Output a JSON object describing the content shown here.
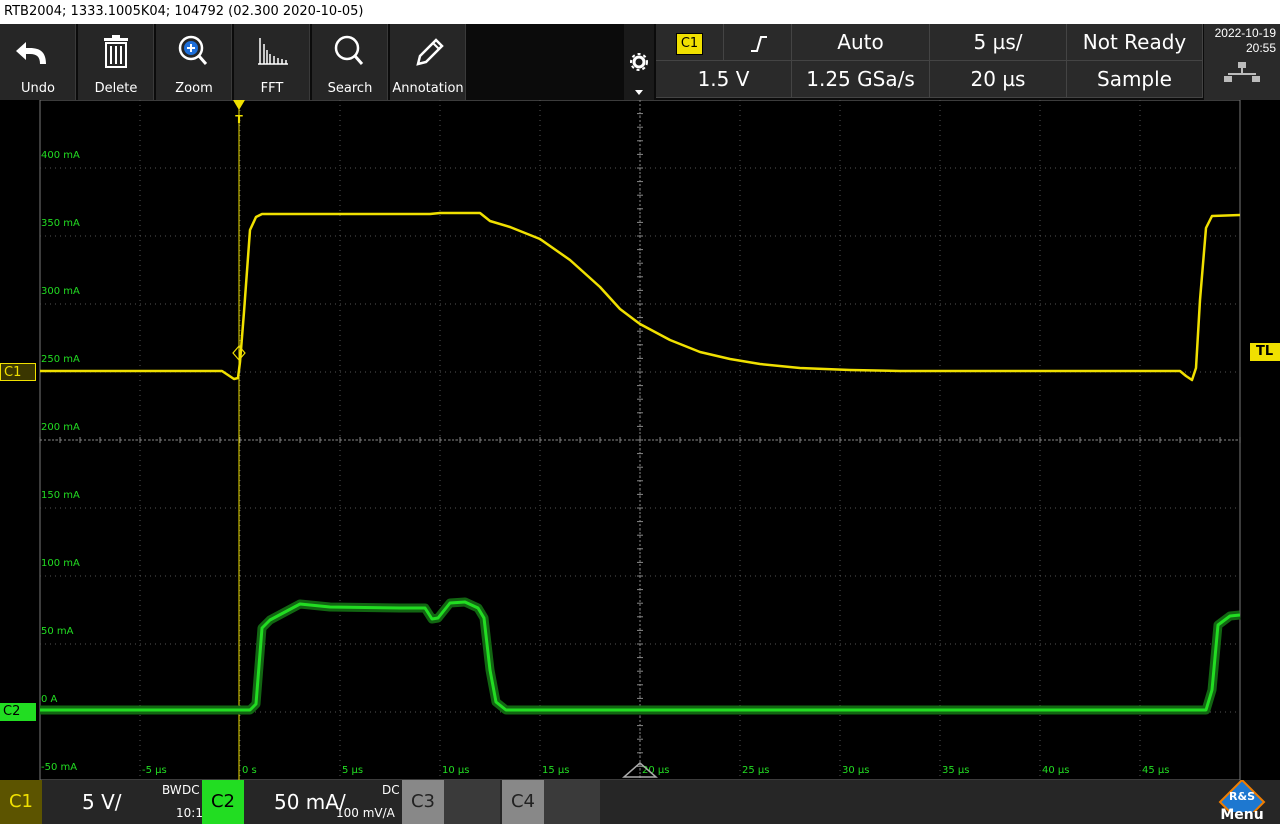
{
  "window": {
    "title": "RTB2004; 1333.1005K04; 104792 (02.300 2020-10-05)"
  },
  "toolbar": {
    "tools": [
      {
        "label": "Undo",
        "icon": "undo-icon"
      },
      {
        "label": "Delete",
        "icon": "trash-icon"
      },
      {
        "label": "Zoom",
        "icon": "zoom-icon"
      },
      {
        "label": "FFT",
        "icon": "fft-icon"
      },
      {
        "label": "Search",
        "icon": "search-icon"
      },
      {
        "label": "Annotation",
        "icon": "pencil-icon"
      }
    ]
  },
  "status": {
    "trigger_source": "C1",
    "trigger_slope_icon": "rising-edge-icon",
    "trigger_mode": "Auto",
    "timebase": "5 µs/",
    "acq_state": "Not Ready",
    "trigger_level": "1.5 V",
    "sample_rate": "1.25 GSa/s",
    "trigger_position": "20 µs",
    "acq_mode": "Sample",
    "date": "2022-10-19",
    "time": "20:55",
    "network_icon": "network-icon"
  },
  "scope": {
    "y_labels": [
      "400 mA",
      "350 mA",
      "300 mA",
      "250 mA",
      "200 mA",
      "150 mA",
      "100 mA",
      "50 mA",
      "0 A",
      "-50 mA"
    ],
    "x_labels": [
      "-5 µs",
      "0 s",
      "5 µs",
      "10 µs",
      "15 µs",
      "20 µs",
      "25 µs",
      "30 µs",
      "35 µs",
      "40 µs",
      "45 µs"
    ],
    "marker_c1": "C1",
    "marker_c2": "C2",
    "marker_tl": "TL",
    "trigger_marker": "T"
  },
  "bottom": {
    "c1": {
      "name": "C1",
      "scale": "5 V/",
      "bw": "BW",
      "coupling": "DC",
      "probe": "10:1"
    },
    "c2": {
      "name": "C2",
      "scale": "50 mA/",
      "coupling": "DC",
      "probe": "100 mV/A"
    },
    "c3": {
      "name": "C3"
    },
    "c4": {
      "name": "C4"
    },
    "menu": "Menu",
    "brand_icon": "rohde-schwarz-logo-icon"
  },
  "colors": {
    "ch1": "#f0e000",
    "ch2": "#22dd22",
    "grid": "#555555"
  }
}
